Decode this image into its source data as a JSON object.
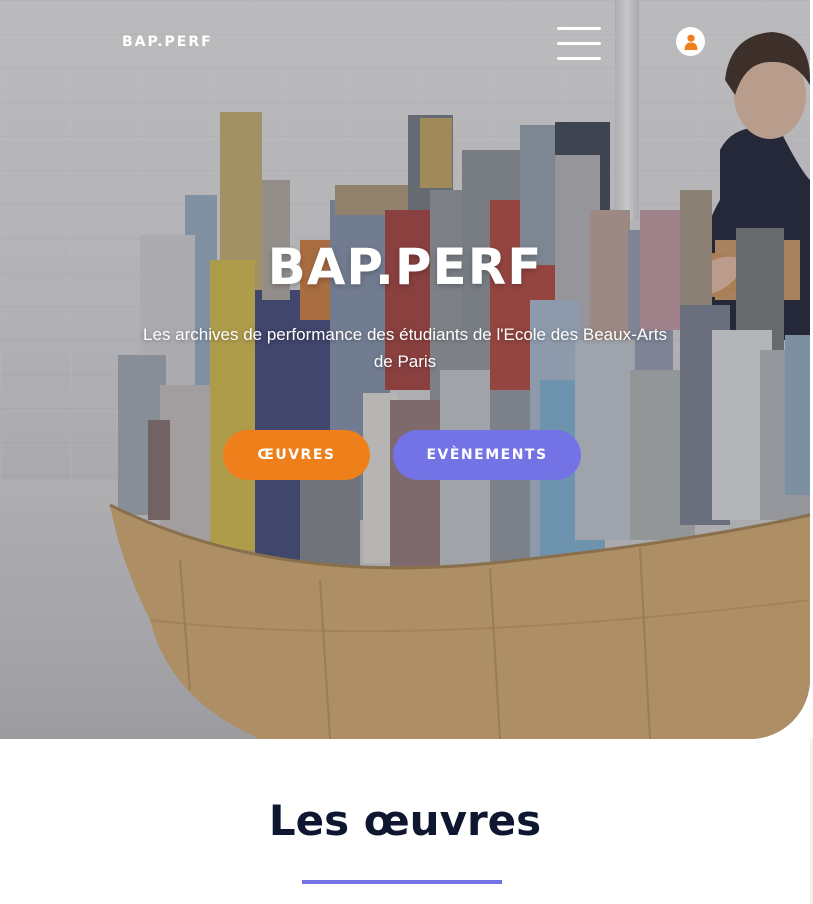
{
  "header": {
    "logo": "BAP.PERF",
    "menu_icon": "hamburger-menu-icon",
    "user_icon": "user-icon"
  },
  "hero": {
    "title": "BAP.PERF",
    "subtitle": "Les archives de performance des étudiants de l'Ecole des Beaux-Arts de Paris",
    "buttons": {
      "oeuvres": "ŒUVRES",
      "evenements": "EVÈNEMENTS"
    }
  },
  "section": {
    "title": "Les œuvres"
  },
  "colors": {
    "orange": "#ef7f1a",
    "violet": "#7473e6",
    "navy": "#0f1630",
    "white": "#ffffff"
  }
}
